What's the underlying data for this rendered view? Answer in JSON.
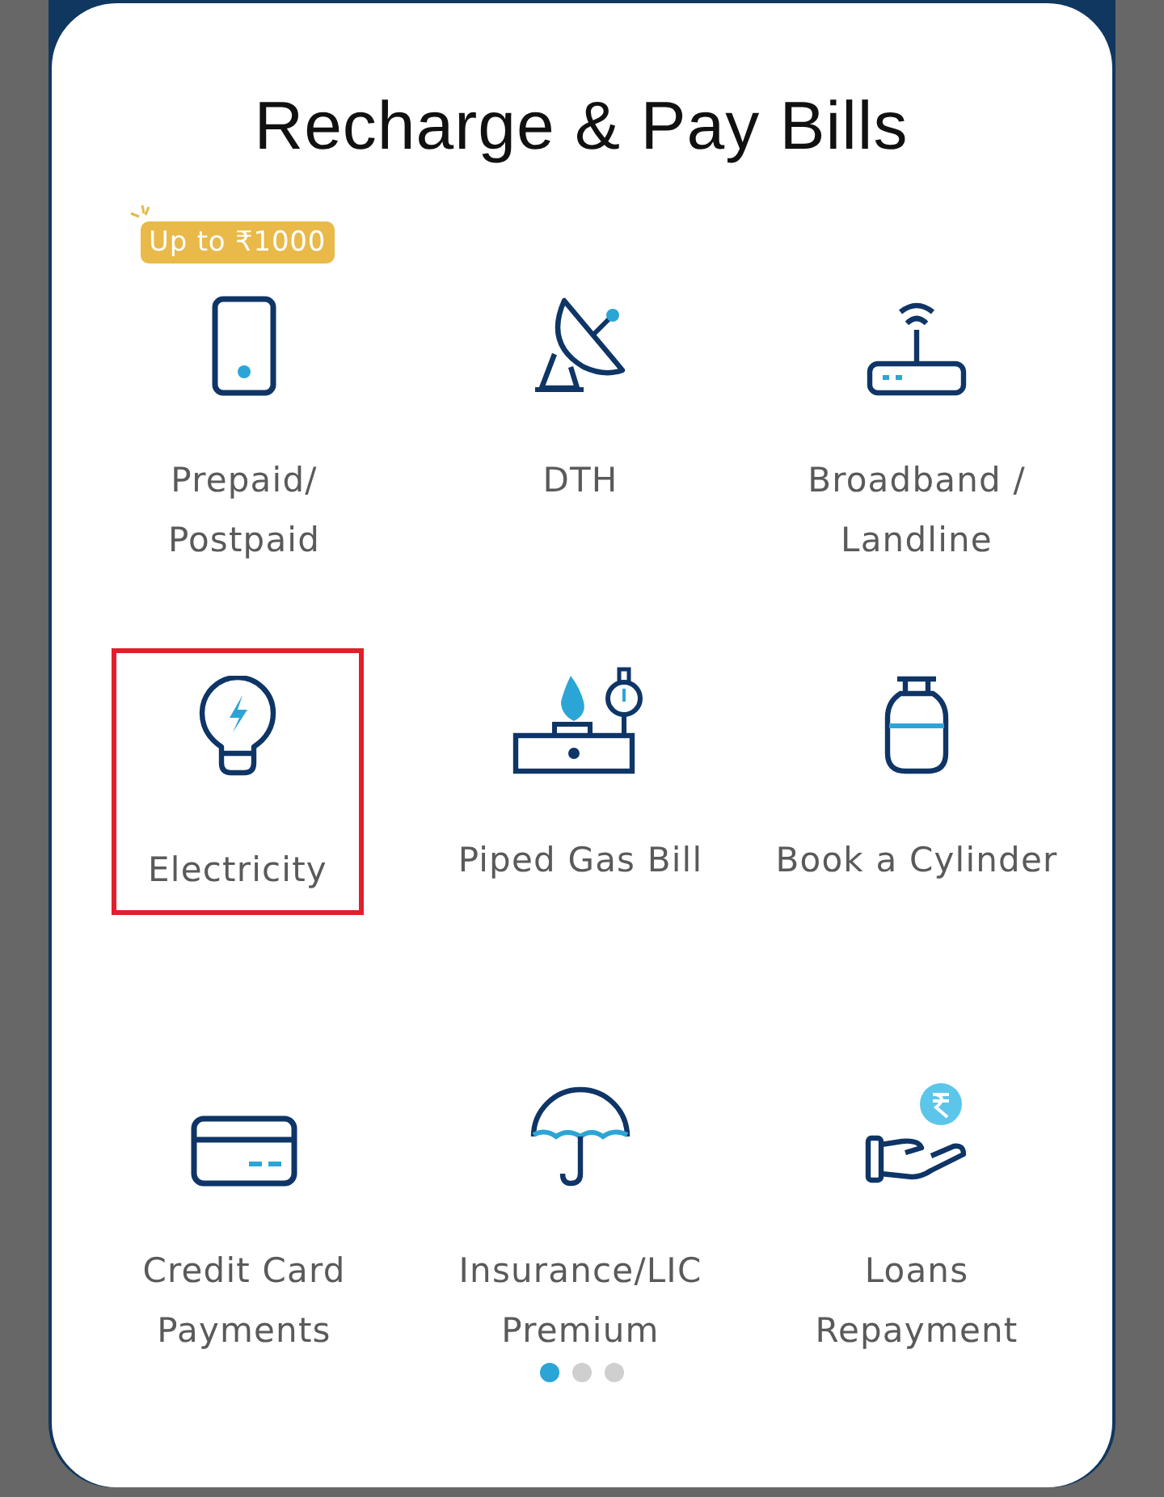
{
  "title": "Recharge & Pay Bills",
  "services": [
    {
      "kind": "phone",
      "label": "Prepaid/\nPostpaid",
      "badge": "Up to ₹1000",
      "highlighted": false
    },
    {
      "kind": "dish",
      "label": "DTH",
      "highlighted": false
    },
    {
      "kind": "router",
      "label": "Broadband /\nLandline",
      "highlighted": false
    },
    {
      "kind": "bulb",
      "label": "Electricity",
      "highlighted": true
    },
    {
      "kind": "stove",
      "label": "Piped Gas Bill",
      "highlighted": false
    },
    {
      "kind": "cylinder",
      "label": "Book a Cylinder",
      "highlighted": false
    },
    {
      "kind": "card",
      "label": "Credit Card\nPayments",
      "highlighted": false
    },
    {
      "kind": "umbrella",
      "label": "Insurance/LIC\nPremium",
      "highlighted": false
    },
    {
      "kind": "hand",
      "label": "Loans\nRepayment",
      "highlighted": false
    }
  ],
  "pages": [
    {
      "selected": true
    },
    {
      "selected": false
    },
    {
      "selected": false
    }
  ]
}
